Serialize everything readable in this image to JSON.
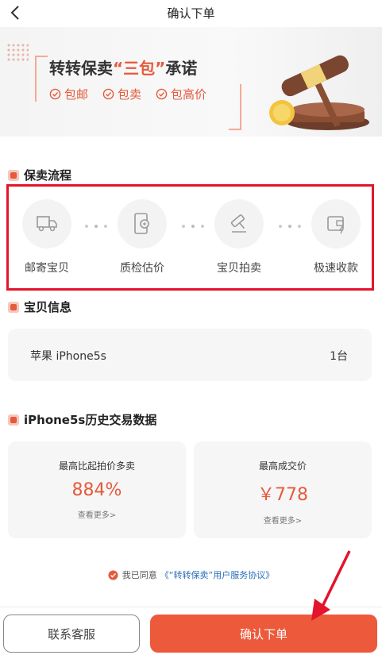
{
  "header": {
    "title": "确认下单",
    "back_icon": "chevron-left-icon"
  },
  "banner": {
    "title_prefix": "转转保卖",
    "title_highlight": "“三包”",
    "title_suffix": "承诺",
    "items": [
      "包邮",
      "包卖",
      "包高价"
    ]
  },
  "flow": {
    "section_title": "保卖流程",
    "steps": [
      {
        "label": "邮寄宝贝",
        "icon": "truck-icon"
      },
      {
        "label": "质检估价",
        "icon": "inspect-phone-icon"
      },
      {
        "label": "宝贝拍卖",
        "icon": "gavel-icon"
      },
      {
        "label": "极速收款",
        "icon": "wallet-icon"
      }
    ]
  },
  "product": {
    "section_title": "宝贝信息",
    "name": "苹果 iPhone5s",
    "quantity": "1台"
  },
  "history": {
    "section_title": "iPhone5s历史交易数据",
    "stats": [
      {
        "label": "最高比起拍价多卖",
        "value": "884%",
        "more": "查看更多>"
      },
      {
        "label": "最高成交价",
        "value": "￥778",
        "more": "查看更多>"
      }
    ]
  },
  "agreement": {
    "prefix": "我已同意",
    "link": "《“转转保卖”用户服务协议》",
    "checked": true
  },
  "actions": {
    "service_label": "联系客服",
    "confirm_label": "确认下单"
  },
  "colors": {
    "accent": "#ec5a3b",
    "highlight_border": "#e3142b",
    "link": "#2a6fb8"
  }
}
